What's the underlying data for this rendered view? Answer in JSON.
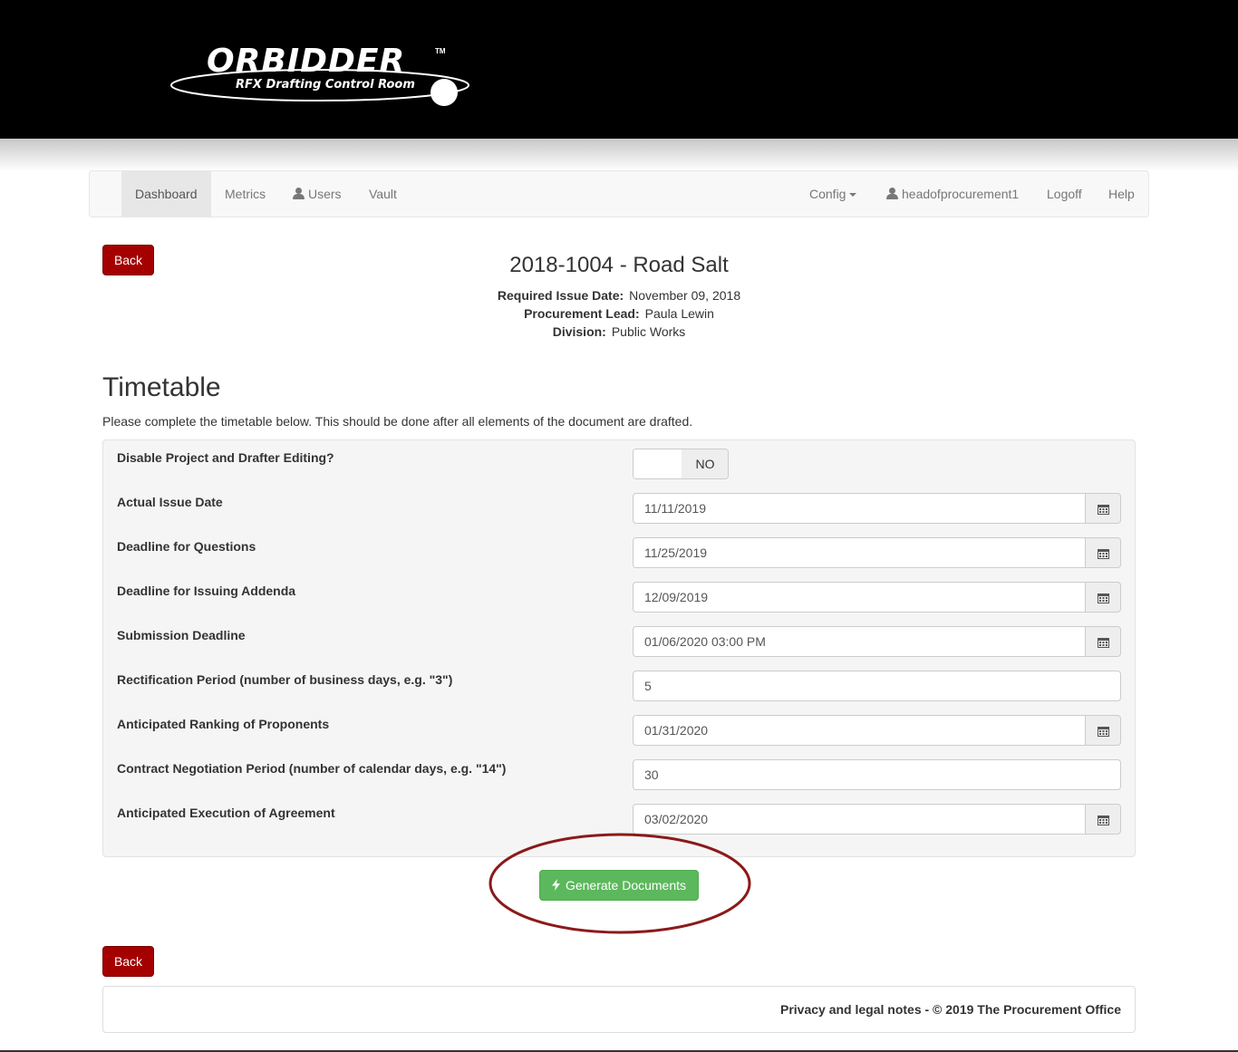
{
  "brand": {
    "logo_title": "ORBIDDER",
    "logo_tm": "TM",
    "logo_subtitle": "RFX Drafting Control Room"
  },
  "nav": {
    "dashboard": "Dashboard",
    "metrics": "Metrics",
    "users": "Users",
    "vault": "Vault",
    "config": "Config",
    "username": "headofprocurement1",
    "logoff": "Logoff",
    "help": "Help"
  },
  "actions": {
    "back_label": "Back",
    "generate_label": "Generate Documents"
  },
  "project": {
    "title": "2018-1004 - Road Salt",
    "required_issue_date_label": "Required Issue Date:",
    "required_issue_date": "November 09, 2018",
    "procurement_lead_label": "Procurement Lead:",
    "procurement_lead": "Paula Lewin",
    "division_label": "Division:",
    "division": "Public Works"
  },
  "timetable": {
    "title": "Timetable",
    "description": "Please complete the timetable below. This should be done after all elements of the document are drafted.",
    "disable_editing_label": "Disable Project and Drafter Editing?",
    "disable_editing_value": "NO",
    "rows": [
      {
        "label": "Actual Issue Date",
        "value": "11/11/2019"
      },
      {
        "label": "Deadline for Questions",
        "value": "11/25/2019"
      },
      {
        "label": "Deadline for Issuing Addenda",
        "value": "12/09/2019"
      },
      {
        "label": "Submission Deadline",
        "value": "01/06/2020 03:00 PM"
      },
      {
        "label": "Rectification Period (number of business days, e.g. \"3\")",
        "value": "5"
      },
      {
        "label": "Anticipated Ranking of Proponents",
        "value": "01/31/2020"
      },
      {
        "label": "Contract Negotiation Period (number of calendar days, e.g. \"14\")",
        "value": "30"
      },
      {
        "label": "Anticipated Execution of Agreement",
        "value": "03/02/2020"
      }
    ]
  },
  "footer": {
    "text": "Privacy and legal notes - © 2019 The Procurement Office"
  },
  "colors": {
    "header_bg": "#000000",
    "back_button": "#a40000",
    "generate_button": "#5cb85c",
    "highlight_ring": "#8b1a1a"
  }
}
